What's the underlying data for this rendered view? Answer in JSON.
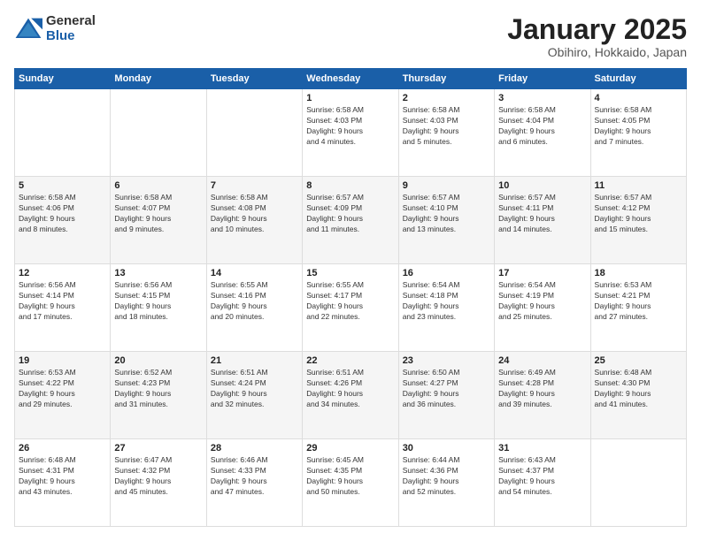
{
  "logo": {
    "general": "General",
    "blue": "Blue"
  },
  "header": {
    "title": "January 2025",
    "subtitle": "Obihiro, Hokkaido, Japan"
  },
  "weekdays": [
    "Sunday",
    "Monday",
    "Tuesday",
    "Wednesday",
    "Thursday",
    "Friday",
    "Saturday"
  ],
  "rows": [
    [
      {
        "day": "",
        "info": ""
      },
      {
        "day": "",
        "info": ""
      },
      {
        "day": "",
        "info": ""
      },
      {
        "day": "1",
        "info": "Sunrise: 6:58 AM\nSunset: 4:03 PM\nDaylight: 9 hours\nand 4 minutes."
      },
      {
        "day": "2",
        "info": "Sunrise: 6:58 AM\nSunset: 4:03 PM\nDaylight: 9 hours\nand 5 minutes."
      },
      {
        "day": "3",
        "info": "Sunrise: 6:58 AM\nSunset: 4:04 PM\nDaylight: 9 hours\nand 6 minutes."
      },
      {
        "day": "4",
        "info": "Sunrise: 6:58 AM\nSunset: 4:05 PM\nDaylight: 9 hours\nand 7 minutes."
      }
    ],
    [
      {
        "day": "5",
        "info": "Sunrise: 6:58 AM\nSunset: 4:06 PM\nDaylight: 9 hours\nand 8 minutes."
      },
      {
        "day": "6",
        "info": "Sunrise: 6:58 AM\nSunset: 4:07 PM\nDaylight: 9 hours\nand 9 minutes."
      },
      {
        "day": "7",
        "info": "Sunrise: 6:58 AM\nSunset: 4:08 PM\nDaylight: 9 hours\nand 10 minutes."
      },
      {
        "day": "8",
        "info": "Sunrise: 6:57 AM\nSunset: 4:09 PM\nDaylight: 9 hours\nand 11 minutes."
      },
      {
        "day": "9",
        "info": "Sunrise: 6:57 AM\nSunset: 4:10 PM\nDaylight: 9 hours\nand 13 minutes."
      },
      {
        "day": "10",
        "info": "Sunrise: 6:57 AM\nSunset: 4:11 PM\nDaylight: 9 hours\nand 14 minutes."
      },
      {
        "day": "11",
        "info": "Sunrise: 6:57 AM\nSunset: 4:12 PM\nDaylight: 9 hours\nand 15 minutes."
      }
    ],
    [
      {
        "day": "12",
        "info": "Sunrise: 6:56 AM\nSunset: 4:14 PM\nDaylight: 9 hours\nand 17 minutes."
      },
      {
        "day": "13",
        "info": "Sunrise: 6:56 AM\nSunset: 4:15 PM\nDaylight: 9 hours\nand 18 minutes."
      },
      {
        "day": "14",
        "info": "Sunrise: 6:55 AM\nSunset: 4:16 PM\nDaylight: 9 hours\nand 20 minutes."
      },
      {
        "day": "15",
        "info": "Sunrise: 6:55 AM\nSunset: 4:17 PM\nDaylight: 9 hours\nand 22 minutes."
      },
      {
        "day": "16",
        "info": "Sunrise: 6:54 AM\nSunset: 4:18 PM\nDaylight: 9 hours\nand 23 minutes."
      },
      {
        "day": "17",
        "info": "Sunrise: 6:54 AM\nSunset: 4:19 PM\nDaylight: 9 hours\nand 25 minutes."
      },
      {
        "day": "18",
        "info": "Sunrise: 6:53 AM\nSunset: 4:21 PM\nDaylight: 9 hours\nand 27 minutes."
      }
    ],
    [
      {
        "day": "19",
        "info": "Sunrise: 6:53 AM\nSunset: 4:22 PM\nDaylight: 9 hours\nand 29 minutes."
      },
      {
        "day": "20",
        "info": "Sunrise: 6:52 AM\nSunset: 4:23 PM\nDaylight: 9 hours\nand 31 minutes."
      },
      {
        "day": "21",
        "info": "Sunrise: 6:51 AM\nSunset: 4:24 PM\nDaylight: 9 hours\nand 32 minutes."
      },
      {
        "day": "22",
        "info": "Sunrise: 6:51 AM\nSunset: 4:26 PM\nDaylight: 9 hours\nand 34 minutes."
      },
      {
        "day": "23",
        "info": "Sunrise: 6:50 AM\nSunset: 4:27 PM\nDaylight: 9 hours\nand 36 minutes."
      },
      {
        "day": "24",
        "info": "Sunrise: 6:49 AM\nSunset: 4:28 PM\nDaylight: 9 hours\nand 39 minutes."
      },
      {
        "day": "25",
        "info": "Sunrise: 6:48 AM\nSunset: 4:30 PM\nDaylight: 9 hours\nand 41 minutes."
      }
    ],
    [
      {
        "day": "26",
        "info": "Sunrise: 6:48 AM\nSunset: 4:31 PM\nDaylight: 9 hours\nand 43 minutes."
      },
      {
        "day": "27",
        "info": "Sunrise: 6:47 AM\nSunset: 4:32 PM\nDaylight: 9 hours\nand 45 minutes."
      },
      {
        "day": "28",
        "info": "Sunrise: 6:46 AM\nSunset: 4:33 PM\nDaylight: 9 hours\nand 47 minutes."
      },
      {
        "day": "29",
        "info": "Sunrise: 6:45 AM\nSunset: 4:35 PM\nDaylight: 9 hours\nand 50 minutes."
      },
      {
        "day": "30",
        "info": "Sunrise: 6:44 AM\nSunset: 4:36 PM\nDaylight: 9 hours\nand 52 minutes."
      },
      {
        "day": "31",
        "info": "Sunrise: 6:43 AM\nSunset: 4:37 PM\nDaylight: 9 hours\nand 54 minutes."
      },
      {
        "day": "",
        "info": ""
      }
    ]
  ]
}
